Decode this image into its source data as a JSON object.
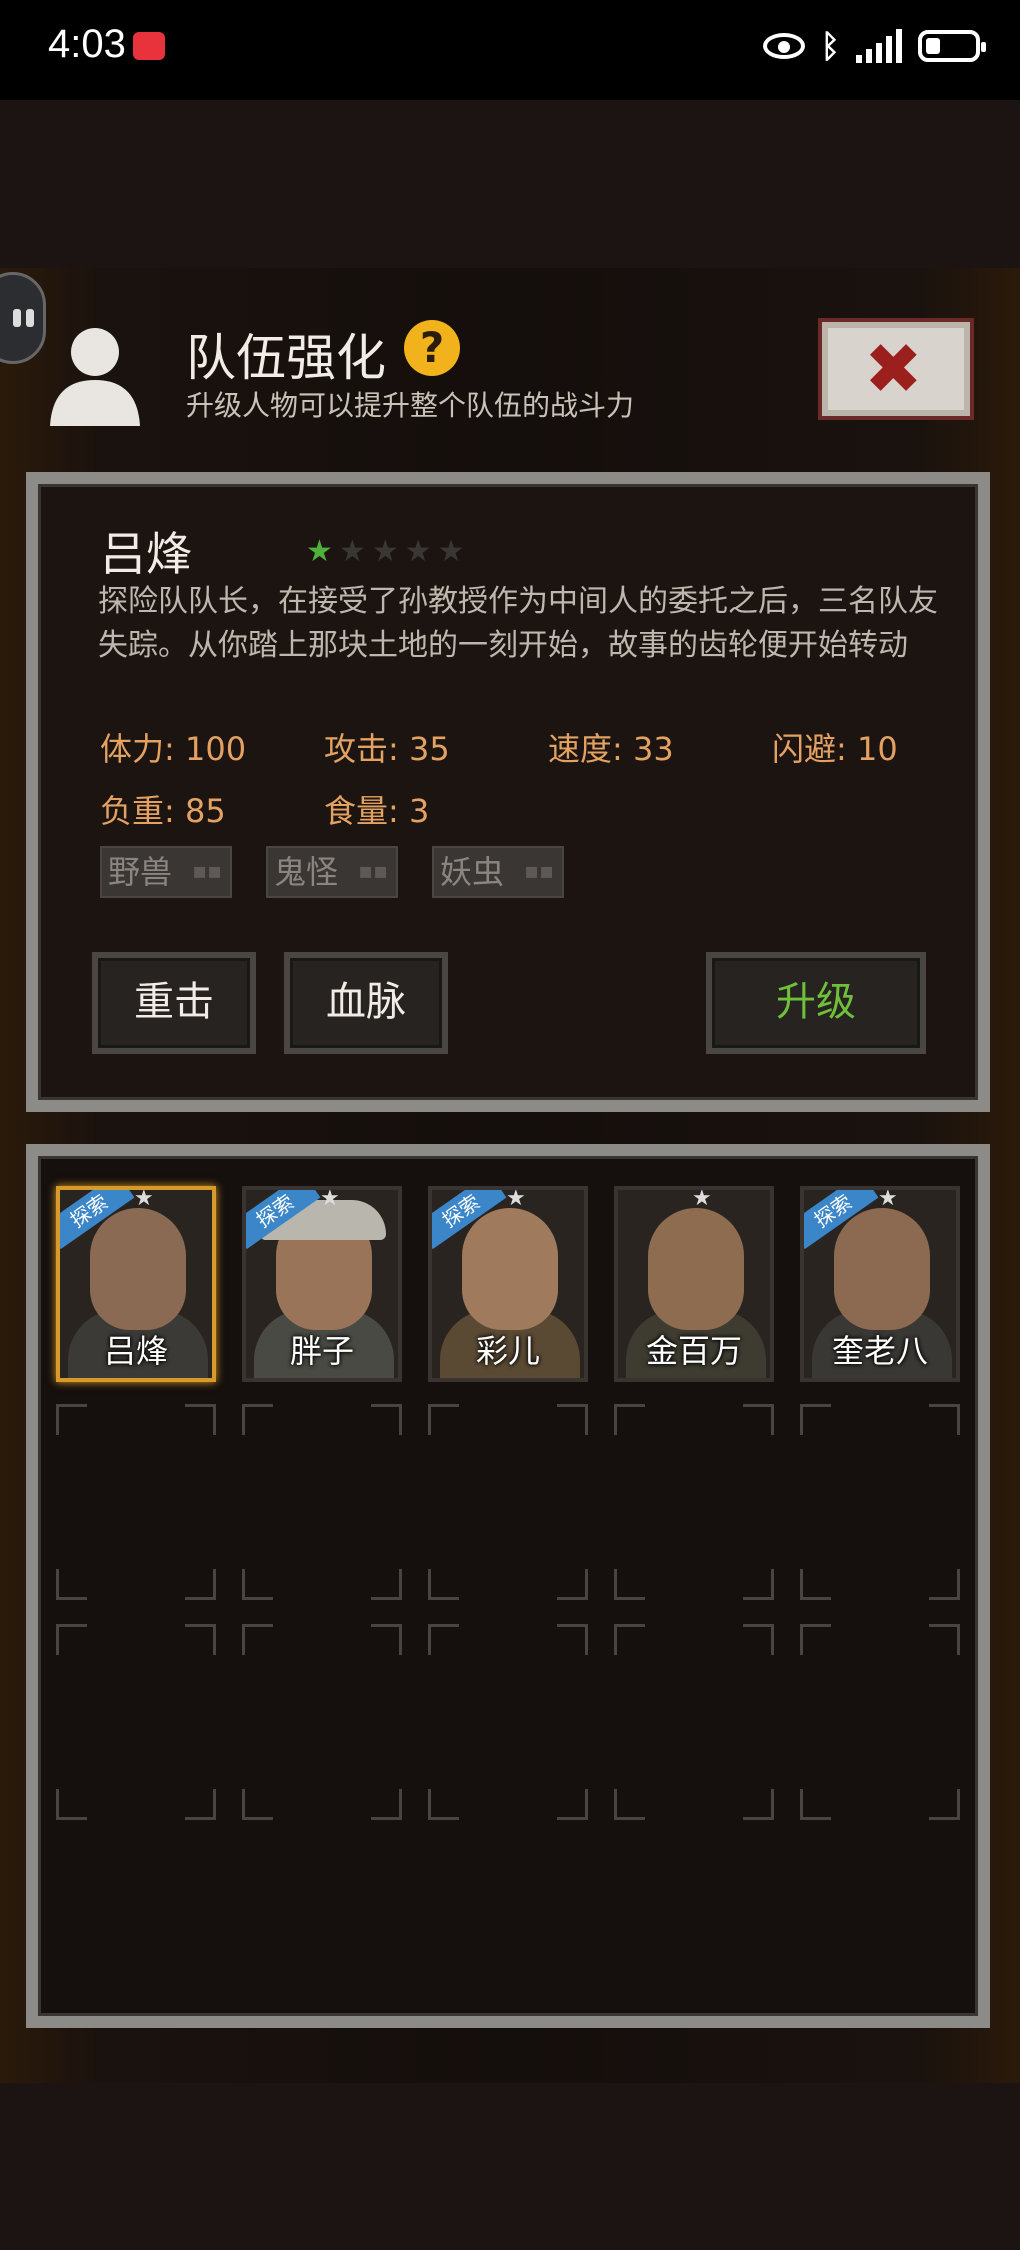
{
  "status_bar": {
    "time": "4:03",
    "icons": [
      "notification-app-icon",
      "eye-icon",
      "bluetooth-icon",
      "signal-icon",
      "battery-icon"
    ]
  },
  "header": {
    "title": "队伍强化",
    "subtitle": "升级人物可以提升整个队伍的战斗力",
    "help_icon": "?",
    "close_icon": "close-x-icon"
  },
  "character": {
    "name": "吕烽",
    "stars_total": 5,
    "stars_filled": 1,
    "description": "探险队队长，在接受了孙教授作为中间人的委托之后，三名队友失踪。从你踏上那块土地的一刻开始，故事的齿轮便开始转动",
    "stats": [
      {
        "label": "体力:",
        "value": "100"
      },
      {
        "label": "攻击:",
        "value": "35"
      },
      {
        "label": "速度:",
        "value": "33"
      },
      {
        "label": "闪避:",
        "value": "10"
      },
      {
        "label": "负重:",
        "value": "85"
      },
      {
        "label": "食量:",
        "value": "3"
      }
    ],
    "tags": [
      "野兽",
      "鬼怪",
      "妖虫"
    ]
  },
  "actions": {
    "heavy_strike": "重击",
    "bloodline": "血脉",
    "upgrade": "升级"
  },
  "roster": {
    "members": [
      {
        "name": "吕烽",
        "badge": "探索",
        "selected": true
      },
      {
        "name": "胖子",
        "badge": "探索",
        "selected": false
      },
      {
        "name": "彩儿",
        "badge": "探索",
        "selected": false
      },
      {
        "name": "金百万",
        "badge": "",
        "selected": false
      },
      {
        "name": "奎老八",
        "badge": "探索",
        "selected": false
      }
    ],
    "empty_slots": 10
  },
  "colors": {
    "stat_orange": "#e3a262",
    "upgrade_green": "#6fbf3a",
    "star_green": "#4fb03c",
    "selected_gold": "#d89a28",
    "explore_blue": "#3a86c9"
  }
}
